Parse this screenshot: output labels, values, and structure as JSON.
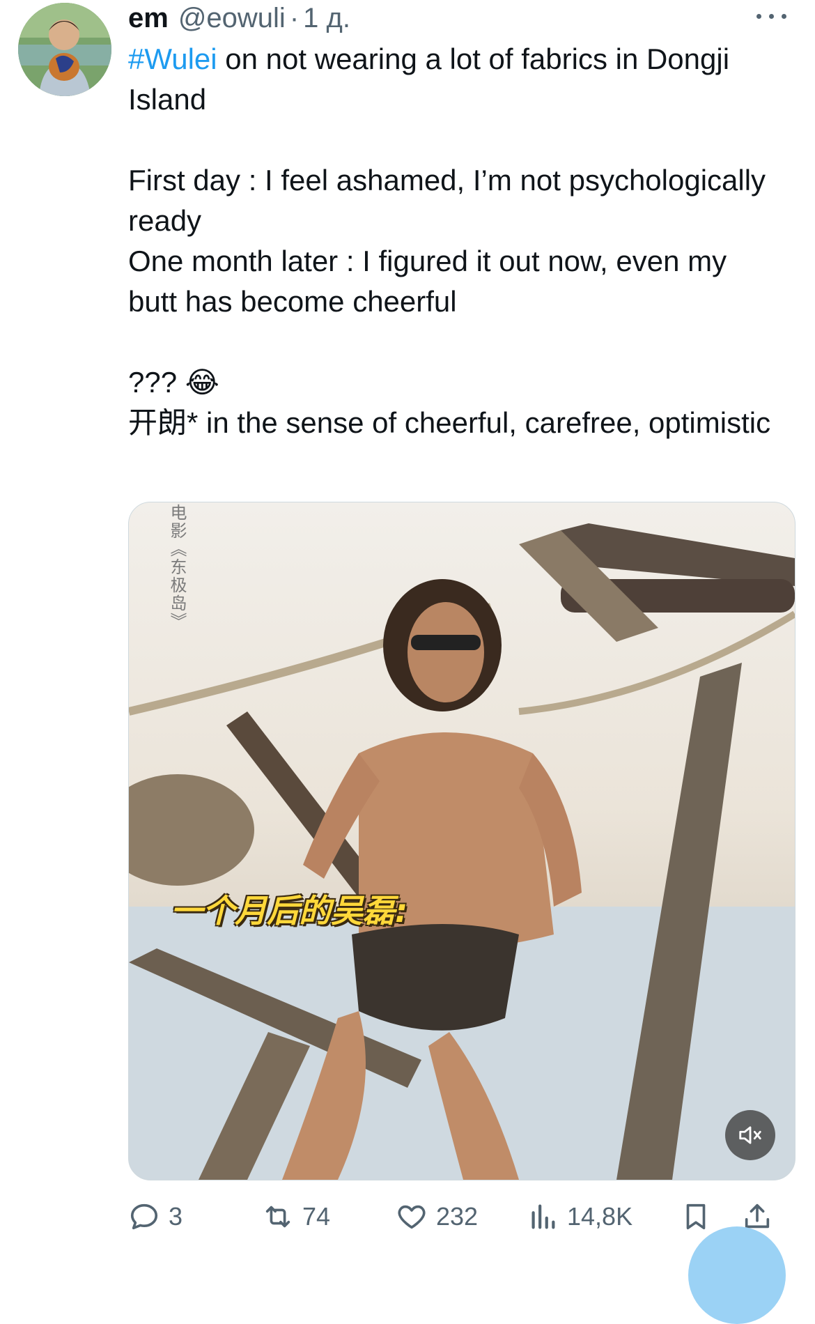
{
  "tweet": {
    "author": {
      "name": "em",
      "handle": "@eowuli",
      "separator": "·",
      "time": "1 д."
    },
    "hashtag": "#Wulei",
    "line1_rest": " on not wearing a lot of fabrics in Dongji Island",
    "line2": "First day : I feel ashamed, I’m not psychologically ready",
    "line3": "One month later : I figured it out now, even my butt has become cheerful",
    "line4": "??? 😂",
    "line5": "开朗* in the sense of cheerful, carefree, optimistic"
  },
  "media": {
    "watermark": "电影《东极岛》",
    "subtitle": "一个月后的吴磊:",
    "mute_icon": "speaker-muted-icon"
  },
  "actions": {
    "reply": {
      "icon": "reply-icon",
      "count": "3"
    },
    "retweet": {
      "icon": "retweet-icon",
      "count": "74"
    },
    "like": {
      "icon": "heart-icon",
      "count": "232"
    },
    "views": {
      "icon": "views-icon",
      "count": "14,8K"
    },
    "bookmark": {
      "icon": "bookmark-icon"
    },
    "share": {
      "icon": "share-icon"
    }
  },
  "colors": {
    "accent": "#1d9bf0",
    "text": "#0f1419",
    "secondary": "#536471",
    "subtitle": "#ffd83a"
  }
}
